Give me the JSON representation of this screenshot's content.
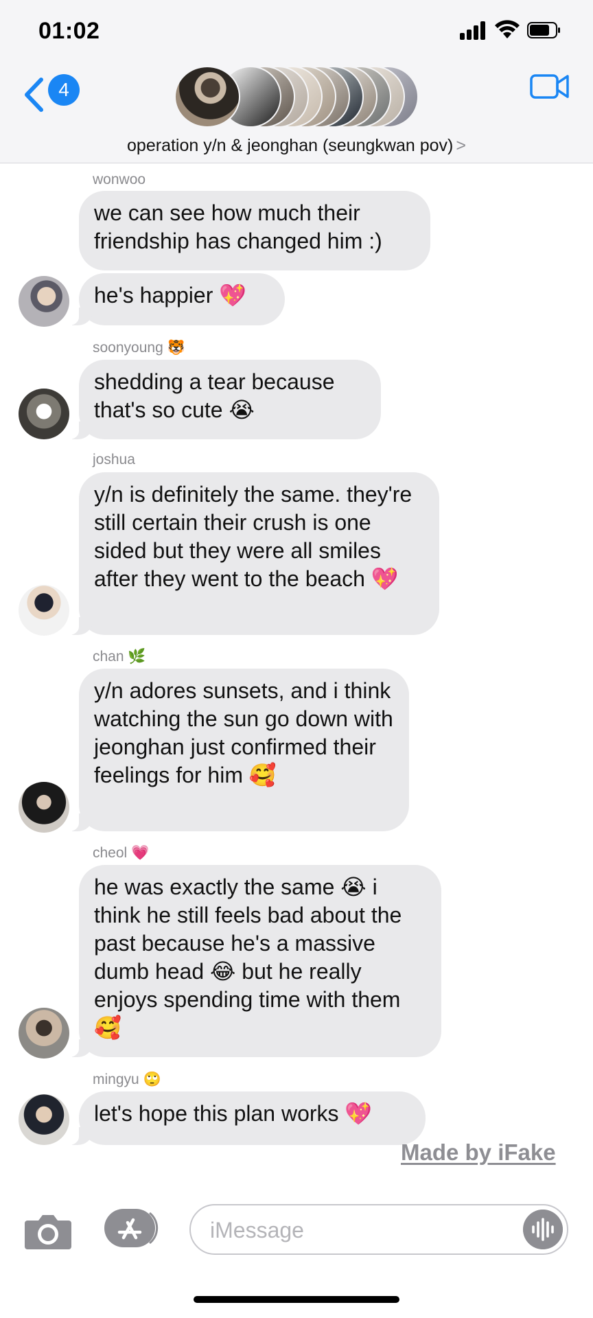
{
  "status_bar": {
    "time": "01:02"
  },
  "header": {
    "back_count": "4",
    "group_name": "operation y/n & jeonghan (seungkwan pov)",
    "chevron": ">"
  },
  "messages": [
    {
      "sender": "wonwoo",
      "sender_emoji": "",
      "text": "we can see how much their friendship has changed him :)"
    },
    {
      "sender": "",
      "sender_emoji": "",
      "text": "he's happier",
      "emoji": "💖"
    },
    {
      "sender": "soonyoung",
      "sender_emoji": "🐯",
      "text": "shedding a tear because that's so cute",
      "emoji": "😭"
    },
    {
      "sender": "joshua",
      "sender_emoji": "",
      "text": "y/n is definitely the same. they're still certain their crush is one sided but they were all smiles after they went to the beach",
      "emoji": "💖"
    },
    {
      "sender": "chan",
      "sender_emoji": "🌿",
      "text": "y/n adores sunsets, and i think watching the sun go down with jeonghan just confirmed their feelings for him",
      "emoji": "🥰"
    },
    {
      "sender": "cheol",
      "sender_emoji": "💗",
      "text_parts": [
        "he was exactly the same",
        "😭",
        "i think he still feels bad about the past because he's a massive dumb head",
        "😂",
        "but he really enjoys spending time with them",
        "🥰"
      ]
    },
    {
      "sender": "mingyu",
      "sender_emoji": "🙄",
      "text": "let's hope this plan works",
      "emoji": "💖"
    }
  ],
  "watermark": "Made by iFake",
  "composer": {
    "placeholder": "iMessage"
  },
  "icons": [
    "back-chevron-icon",
    "video-camera-icon",
    "camera-icon",
    "app-store-icon",
    "audio-waveform-icon"
  ],
  "colors": {
    "accent": "#1a86f4",
    "bubble": "#e9e9eb",
    "sender_text": "#8a8a8e"
  }
}
